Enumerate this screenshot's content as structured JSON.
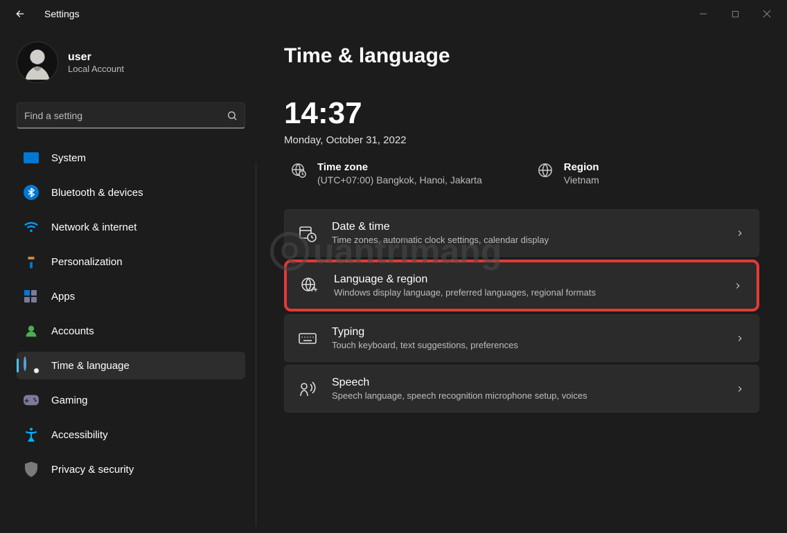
{
  "app": {
    "title": "Settings"
  },
  "window_controls": {
    "min": "−",
    "max": "☐",
    "close": "✕"
  },
  "profile": {
    "name": "user",
    "type": "Local Account"
  },
  "search": {
    "placeholder": "Find a setting"
  },
  "sidebar": {
    "items": [
      {
        "label": "System"
      },
      {
        "label": "Bluetooth & devices"
      },
      {
        "label": "Network & internet"
      },
      {
        "label": "Personalization"
      },
      {
        "label": "Apps"
      },
      {
        "label": "Accounts"
      },
      {
        "label": "Time & language"
      },
      {
        "label": "Gaming"
      },
      {
        "label": "Accessibility"
      },
      {
        "label": "Privacy & security"
      }
    ],
    "active_index": 6
  },
  "page": {
    "title": "Time & language",
    "clock": "14:37",
    "date": "Monday, October 31, 2022",
    "info": {
      "timezone": {
        "label": "Time zone",
        "value": "(UTC+07:00) Bangkok, Hanoi, Jakarta"
      },
      "region": {
        "label": "Region",
        "value": "Vietnam"
      }
    },
    "cards": [
      {
        "title": "Date & time",
        "sub": "Time zones, automatic clock settings, calendar display"
      },
      {
        "title": "Language & region",
        "sub": "Windows display language, preferred languages, regional formats"
      },
      {
        "title": "Typing",
        "sub": "Touch keyboard, text suggestions, preferences"
      },
      {
        "title": "Speech",
        "sub": "Speech language, speech recognition microphone setup, voices"
      }
    ],
    "highlight_index": 1
  },
  "watermark": {
    "letter": "Q",
    "text": "uantrimang"
  }
}
